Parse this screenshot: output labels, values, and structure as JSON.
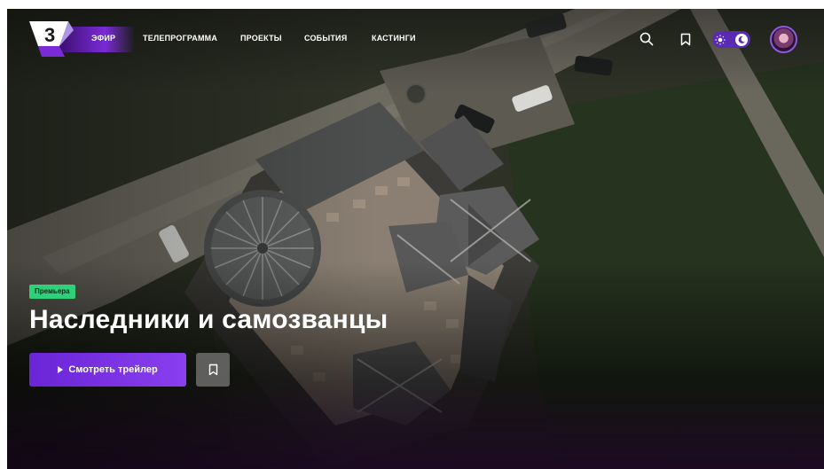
{
  "brand": {
    "logo_text": "3",
    "accent": "#7a2bd6"
  },
  "nav": {
    "items": [
      {
        "label": "ЭФИР",
        "active": true
      },
      {
        "label": "ТЕЛЕПРОГРАММА",
        "active": false
      },
      {
        "label": "ПРОЕКТЫ",
        "active": false
      },
      {
        "label": "СОБЫТИЯ",
        "active": false
      },
      {
        "label": "КАСТИНГИ",
        "active": false
      }
    ]
  },
  "header_icons": [
    "search-icon",
    "bookmark-icon",
    "sun-icon",
    "moon-icon",
    "avatar"
  ],
  "hero": {
    "badge": "Премьера",
    "badge_color": "#2fd07a",
    "title": "Наследники и самозванцы",
    "cta_label": "Смотреть трейлер",
    "cta_color": "#7a2bd6"
  }
}
